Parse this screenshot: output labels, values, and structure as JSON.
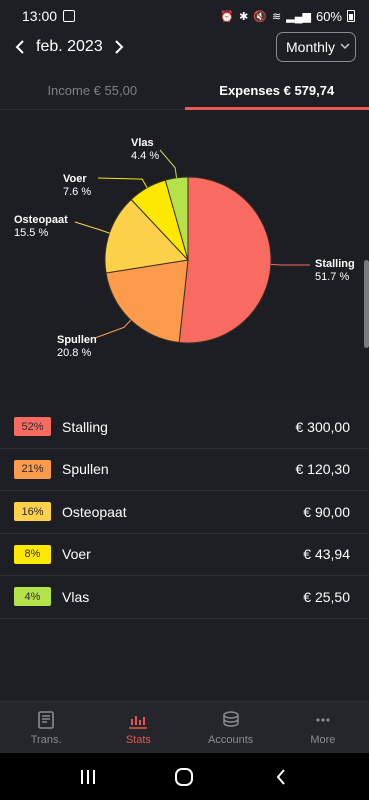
{
  "status_bar": {
    "time": "13:00",
    "battery": "60%",
    "icons": [
      "alarm-icon",
      "bluetooth-icon",
      "mute-icon",
      "wifi-icon",
      "signal-icon",
      "battery-icon"
    ]
  },
  "header": {
    "month": "feb. 2023",
    "period": "Monthly"
  },
  "tabs": {
    "income": "Income  € 55,00",
    "expenses": "Expenses  € 579,74",
    "active": "expenses",
    "active_color": "#ee5a53"
  },
  "chart_data": {
    "type": "pie",
    "slices": [
      {
        "label": "Stalling",
        "pct_label": "51.7 %",
        "value": 51.7,
        "color": "#f96b61"
      },
      {
        "label": "Spullen",
        "pct_label": "20.8 %",
        "value": 20.8,
        "color": "#fb9b4b"
      },
      {
        "label": "Osteopaat",
        "pct_label": "15.5 %",
        "value": 15.5,
        "color": "#fdd24a"
      },
      {
        "label": "Voer",
        "pct_label": "7.6 %",
        "value": 7.6,
        "color": "#fde802"
      },
      {
        "label": "Vlas",
        "pct_label": "4.4 %",
        "value": 4.4,
        "color": "#b4e24a"
      }
    ]
  },
  "categories": [
    {
      "badge": "52%",
      "name": "Stalling",
      "amount": "€ 300,00",
      "color": "#f96b61"
    },
    {
      "badge": "21%",
      "name": "Spullen",
      "amount": "€ 120,30",
      "color": "#fb9b4b"
    },
    {
      "badge": "16%",
      "name": "Osteopaat",
      "amount": "€ 90,00",
      "color": "#fdd24a"
    },
    {
      "badge": "8%",
      "name": "Voer",
      "amount": "€ 43,94",
      "color": "#fde802"
    },
    {
      "badge": "4%",
      "name": "Vlas",
      "amount": "€ 25,50",
      "color": "#b4e24a"
    }
  ],
  "bottom_nav": [
    {
      "label": "Trans.",
      "icon": "book-icon"
    },
    {
      "label": "Stats",
      "icon": "bar-chart-icon",
      "active": true
    },
    {
      "label": "Accounts",
      "icon": "coins-icon"
    },
    {
      "label": "More",
      "icon": "more-dots-icon"
    }
  ]
}
